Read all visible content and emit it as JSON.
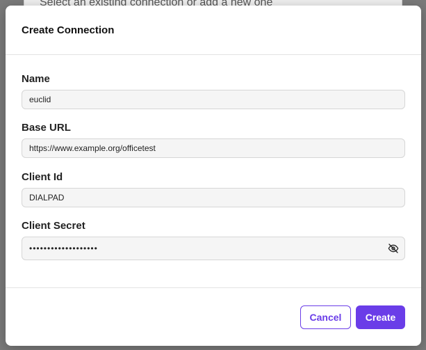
{
  "background": {
    "text": "Select an existing connection or add a new one"
  },
  "modal": {
    "title": "Create Connection",
    "fields": {
      "name": {
        "label": "Name",
        "value": "euclid"
      },
      "base_url": {
        "label": "Base URL",
        "value": "https://www.example.org/officetest"
      },
      "client_id": {
        "label": "Client Id",
        "value": "DIALPAD"
      },
      "client_secret": {
        "label": "Client Secret",
        "value": "•••••••••••••••••••"
      }
    },
    "buttons": {
      "cancel": "Cancel",
      "create": "Create"
    }
  },
  "icons": {
    "secret_toggle": "eye-off-icon"
  },
  "colors": {
    "accent": "#6a3de8",
    "overlay": "#7a7a7a"
  }
}
